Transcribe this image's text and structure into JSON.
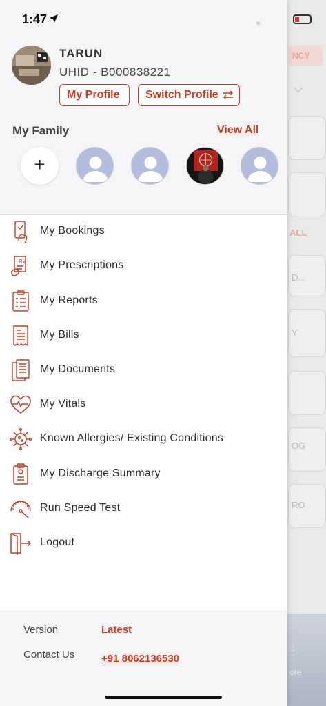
{
  "status_bar": {
    "time": "1:47"
  },
  "background": {
    "chip": "NCY",
    "all": "ALL",
    "cards": [
      "D...",
      "Y",
      "OG",
      "RO"
    ],
    "more": "ore"
  },
  "profile": {
    "name": "TARUN",
    "uhid": "UHID - B000838221",
    "my_profile_label": "My Profile",
    "switch_profile_label": "Switch Profile"
  },
  "family": {
    "title": "My Family",
    "view_all": "View All",
    "add_symbol": "+"
  },
  "menu": [
    {
      "label": "My Bookings",
      "icon": "bookings-icon"
    },
    {
      "label": "My Prescriptions",
      "icon": "prescription-icon"
    },
    {
      "label": "My Reports",
      "icon": "reports-icon"
    },
    {
      "label": "My Bills",
      "icon": "bills-icon"
    },
    {
      "label": "My Documents",
      "icon": "documents-icon"
    },
    {
      "label": "My Vitals",
      "icon": "heart-pulse-icon"
    },
    {
      "label": "Known Allergies/ Existing Conditions",
      "icon": "virus-icon"
    },
    {
      "label": "My Discharge Summary",
      "icon": "clipboard-icon"
    },
    {
      "label": "Run Speed Test",
      "icon": "speedometer-icon"
    },
    {
      "label": "Logout",
      "icon": "logout-icon"
    }
  ],
  "footer": {
    "version_label": "Version",
    "version_value": "Latest",
    "contact_label": "Contact Us",
    "contact_value": "+91 8062136530"
  },
  "colors": {
    "accent": "#cc3a1f",
    "header_bg": "#f5f5f7"
  }
}
